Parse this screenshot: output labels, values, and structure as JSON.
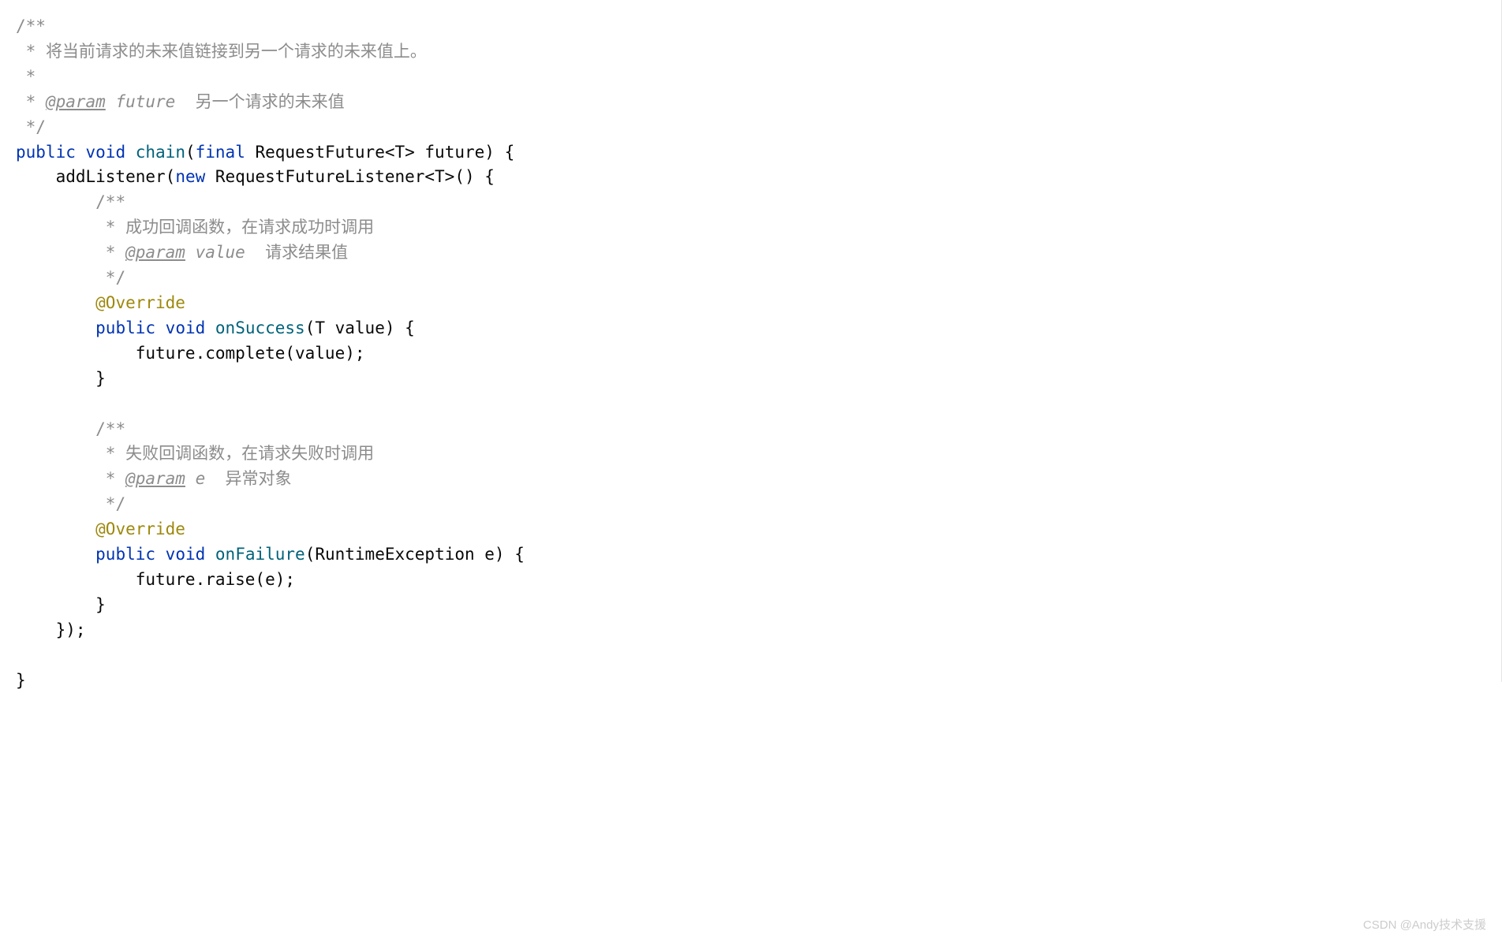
{
  "code": {
    "line1": "/**",
    "line2_prefix": " * ",
    "line2_text": "将当前请求的未来值链接到另一个请求的未来值上。",
    "line3": " *",
    "line4_prefix": " * ",
    "line4_tag": "@param",
    "line4_param": " future",
    "line4_desc": "  另一个请求的未来值",
    "line5": " */",
    "line6_public": "public",
    "line6_void": "void",
    "line6_method": "chain",
    "line6_paren_open": "(",
    "line6_final": "final",
    "line6_type": " RequestFuture<T> future) {",
    "line7_indent": "    ",
    "line7_method": "addListener",
    "line7_paren": "(",
    "line7_new": "new",
    "line7_rest": " RequestFutureListener<T>() {",
    "line8_indent": "        ",
    "line8": "/**",
    "line9_indent": "         ",
    "line9_prefix": "* ",
    "line9_text": "成功回调函数，在请求成功时调用",
    "line10_indent": "         ",
    "line10_prefix": "* ",
    "line10_tag": "@param",
    "line10_param": " value",
    "line10_desc": "  请求结果值",
    "line11_indent": "         ",
    "line11": "*/",
    "line12_indent": "        ",
    "line12": "@Override",
    "line13_indent": "        ",
    "line13_public": "public",
    "line13_void": "void",
    "line13_method": "onSuccess",
    "line13_rest": "(T value) {",
    "line14_indent": "            ",
    "line14": "future.complete(value);",
    "line15_indent": "        ",
    "line15": "}",
    "line17_indent": "        ",
    "line17": "/**",
    "line18_indent": "         ",
    "line18_prefix": "* ",
    "line18_text": "失败回调函数，在请求失败时调用",
    "line19_indent": "         ",
    "line19_prefix": "* ",
    "line19_tag": "@param",
    "line19_param": " e",
    "line19_desc": "  异常对象",
    "line20_indent": "         ",
    "line20": "*/",
    "line21_indent": "        ",
    "line21": "@Override",
    "line22_indent": "        ",
    "line22_public": "public",
    "line22_void": "void",
    "line22_method": "onFailure",
    "line22_rest": "(RuntimeException e) {",
    "line23_indent": "            ",
    "line23": "future.raise(e);",
    "line24_indent": "        ",
    "line24": "}",
    "line25_indent": "    ",
    "line25": "});",
    "line27": "}"
  },
  "watermark": "CSDN @Andy技术支援"
}
